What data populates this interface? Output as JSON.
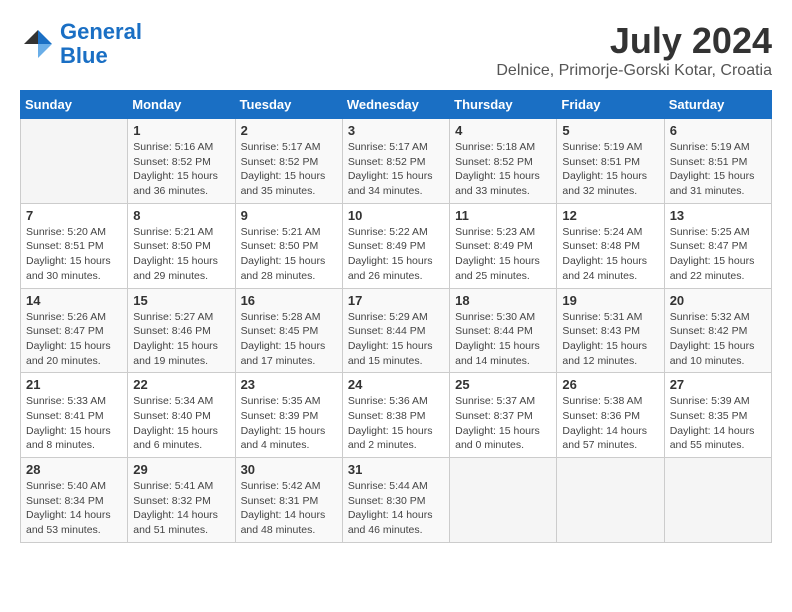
{
  "header": {
    "logo_line1": "General",
    "logo_line2": "Blue",
    "month": "July 2024",
    "location": "Delnice, Primorje-Gorski Kotar, Croatia"
  },
  "weekdays": [
    "Sunday",
    "Monday",
    "Tuesday",
    "Wednesday",
    "Thursday",
    "Friday",
    "Saturday"
  ],
  "weeks": [
    [
      {
        "day": "",
        "info": ""
      },
      {
        "day": "1",
        "info": "Sunrise: 5:16 AM\nSunset: 8:52 PM\nDaylight: 15 hours\nand 36 minutes."
      },
      {
        "day": "2",
        "info": "Sunrise: 5:17 AM\nSunset: 8:52 PM\nDaylight: 15 hours\nand 35 minutes."
      },
      {
        "day": "3",
        "info": "Sunrise: 5:17 AM\nSunset: 8:52 PM\nDaylight: 15 hours\nand 34 minutes."
      },
      {
        "day": "4",
        "info": "Sunrise: 5:18 AM\nSunset: 8:52 PM\nDaylight: 15 hours\nand 33 minutes."
      },
      {
        "day": "5",
        "info": "Sunrise: 5:19 AM\nSunset: 8:51 PM\nDaylight: 15 hours\nand 32 minutes."
      },
      {
        "day": "6",
        "info": "Sunrise: 5:19 AM\nSunset: 8:51 PM\nDaylight: 15 hours\nand 31 minutes."
      }
    ],
    [
      {
        "day": "7",
        "info": "Sunrise: 5:20 AM\nSunset: 8:51 PM\nDaylight: 15 hours\nand 30 minutes."
      },
      {
        "day": "8",
        "info": "Sunrise: 5:21 AM\nSunset: 8:50 PM\nDaylight: 15 hours\nand 29 minutes."
      },
      {
        "day": "9",
        "info": "Sunrise: 5:21 AM\nSunset: 8:50 PM\nDaylight: 15 hours\nand 28 minutes."
      },
      {
        "day": "10",
        "info": "Sunrise: 5:22 AM\nSunset: 8:49 PM\nDaylight: 15 hours\nand 26 minutes."
      },
      {
        "day": "11",
        "info": "Sunrise: 5:23 AM\nSunset: 8:49 PM\nDaylight: 15 hours\nand 25 minutes."
      },
      {
        "day": "12",
        "info": "Sunrise: 5:24 AM\nSunset: 8:48 PM\nDaylight: 15 hours\nand 24 minutes."
      },
      {
        "day": "13",
        "info": "Sunrise: 5:25 AM\nSunset: 8:47 PM\nDaylight: 15 hours\nand 22 minutes."
      }
    ],
    [
      {
        "day": "14",
        "info": "Sunrise: 5:26 AM\nSunset: 8:47 PM\nDaylight: 15 hours\nand 20 minutes."
      },
      {
        "day": "15",
        "info": "Sunrise: 5:27 AM\nSunset: 8:46 PM\nDaylight: 15 hours\nand 19 minutes."
      },
      {
        "day": "16",
        "info": "Sunrise: 5:28 AM\nSunset: 8:45 PM\nDaylight: 15 hours\nand 17 minutes."
      },
      {
        "day": "17",
        "info": "Sunrise: 5:29 AM\nSunset: 8:44 PM\nDaylight: 15 hours\nand 15 minutes."
      },
      {
        "day": "18",
        "info": "Sunrise: 5:30 AM\nSunset: 8:44 PM\nDaylight: 15 hours\nand 14 minutes."
      },
      {
        "day": "19",
        "info": "Sunrise: 5:31 AM\nSunset: 8:43 PM\nDaylight: 15 hours\nand 12 minutes."
      },
      {
        "day": "20",
        "info": "Sunrise: 5:32 AM\nSunset: 8:42 PM\nDaylight: 15 hours\nand 10 minutes."
      }
    ],
    [
      {
        "day": "21",
        "info": "Sunrise: 5:33 AM\nSunset: 8:41 PM\nDaylight: 15 hours\nand 8 minutes."
      },
      {
        "day": "22",
        "info": "Sunrise: 5:34 AM\nSunset: 8:40 PM\nDaylight: 15 hours\nand 6 minutes."
      },
      {
        "day": "23",
        "info": "Sunrise: 5:35 AM\nSunset: 8:39 PM\nDaylight: 15 hours\nand 4 minutes."
      },
      {
        "day": "24",
        "info": "Sunrise: 5:36 AM\nSunset: 8:38 PM\nDaylight: 15 hours\nand 2 minutes."
      },
      {
        "day": "25",
        "info": "Sunrise: 5:37 AM\nSunset: 8:37 PM\nDaylight: 15 hours\nand 0 minutes."
      },
      {
        "day": "26",
        "info": "Sunrise: 5:38 AM\nSunset: 8:36 PM\nDaylight: 14 hours\nand 57 minutes."
      },
      {
        "day": "27",
        "info": "Sunrise: 5:39 AM\nSunset: 8:35 PM\nDaylight: 14 hours\nand 55 minutes."
      }
    ],
    [
      {
        "day": "28",
        "info": "Sunrise: 5:40 AM\nSunset: 8:34 PM\nDaylight: 14 hours\nand 53 minutes."
      },
      {
        "day": "29",
        "info": "Sunrise: 5:41 AM\nSunset: 8:32 PM\nDaylight: 14 hours\nand 51 minutes."
      },
      {
        "day": "30",
        "info": "Sunrise: 5:42 AM\nSunset: 8:31 PM\nDaylight: 14 hours\nand 48 minutes."
      },
      {
        "day": "31",
        "info": "Sunrise: 5:44 AM\nSunset: 8:30 PM\nDaylight: 14 hours\nand 46 minutes."
      },
      {
        "day": "",
        "info": ""
      },
      {
        "day": "",
        "info": ""
      },
      {
        "day": "",
        "info": ""
      }
    ]
  ]
}
